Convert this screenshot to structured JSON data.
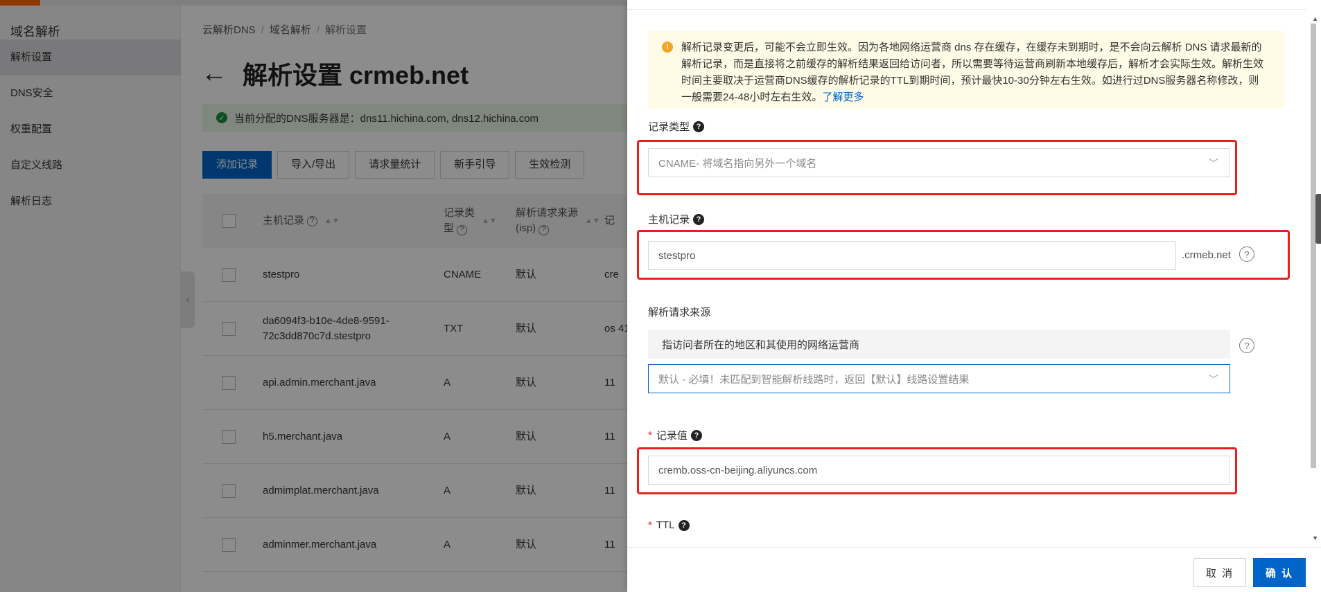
{
  "sidebar": {
    "title": "域名解析",
    "items": [
      {
        "label": "解析设置",
        "active": true
      },
      {
        "label": "DNS安全",
        "active": false
      },
      {
        "label": "权重配置",
        "active": false
      },
      {
        "label": "自定义线路",
        "active": false
      },
      {
        "label": "解析日志",
        "active": false
      }
    ]
  },
  "breadcrumb": [
    "云解析DNS",
    "域名解析",
    "解析设置"
  ],
  "page": {
    "title": "解析设置 crmeb.net",
    "dns_notice": "当前分配的DNS服务器是：dns11.hichina.com, dns12.hichina.com"
  },
  "toolbar": [
    "添加记录",
    "导入/导出",
    "请求量统计",
    "新手引导",
    "生效检测"
  ],
  "table": {
    "headers": {
      "host": "主机记录",
      "type_line1": "记录类",
      "type_line2": "型",
      "isp_line1": "解析请求来源",
      "isp_line2": "(isp)",
      "value": "记"
    },
    "rows": [
      {
        "host": "stestpro",
        "type": "CNAME",
        "isp": "默认",
        "value": "cre"
      },
      {
        "host": "da6094f3-b10e-4de8-9591-72c3dd870c7d.stestpro",
        "type": "TXT",
        "isp": "默认",
        "value": "os 41"
      },
      {
        "host": "api.admin.merchant.java",
        "type": "A",
        "isp": "默认",
        "value": "11"
      },
      {
        "host": "h5.merchant.java",
        "type": "A",
        "isp": "默认",
        "value": "11"
      },
      {
        "host": "admimplat.merchant.java",
        "type": "A",
        "isp": "默认",
        "value": "11"
      },
      {
        "host": "adminmer.merchant.java",
        "type": "A",
        "isp": "默认",
        "value": "11"
      }
    ]
  },
  "drawer": {
    "notice_text": "解析记录变更后，可能不会立即生效。因为各地网络运营商 dns 存在缓存，在缓存未到期时，是不会向云解析 DNS 请求最新的解析记录，而是直接将之前缓存的解析结果返回给访问者，所以需要等待运营商刷新本地缓存后，解析才会实际生效。解析生效时间主要取决于运营商DNS缓存的解析记录的TTL到期时间，预计最快10-30分钟左右生效。如进行过DNS服务器名称修改，则一般需要24-48小时左右生效。",
    "notice_link": "了解更多",
    "record_type_label": "记录类型",
    "record_type_value": "CNAME- 将域名指向另外一个域名",
    "host_label": "主机记录",
    "host_value": "stestpro",
    "host_suffix": ".crmeb.net",
    "isp_label": "解析请求来源",
    "isp_info": "指访问者所在的地区和其使用的网络运营商",
    "isp_value": "默认 - 必填！未匹配到智能解析线路时，返回【默认】线路设置结果",
    "value_label": "记录值",
    "value_value": "cremb.oss-cn-beijing.aliyuncs.com",
    "ttl_label": "TTL",
    "cancel_label": "取 消",
    "ok_label": "确 认"
  },
  "colors": {
    "primary": "#0064c8",
    "highlight": "#ee1d1d",
    "notice_bg": "#fffbe6",
    "success_bg": "#e9f6e6"
  }
}
